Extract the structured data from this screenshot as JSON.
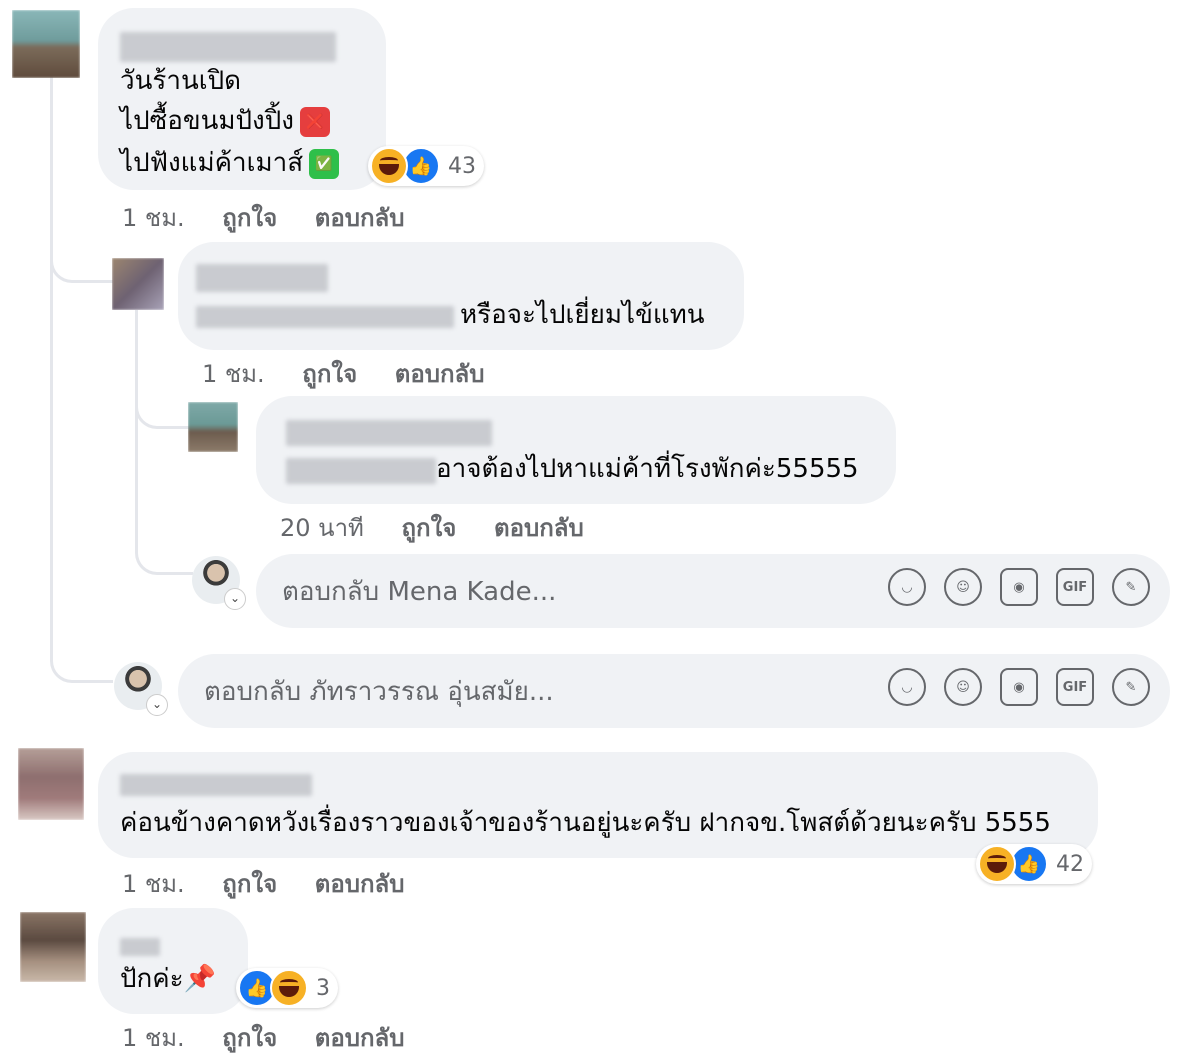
{
  "comments": [
    {
      "lines": [
        "วันร้านเปิด",
        "ไปซื้อขนมปังปิ้ง",
        "ไปฟังแม่ค้าเมาส์"
      ],
      "reaction_count": "43",
      "time": "1 ชม.",
      "like": "ถูกใจ",
      "reply": "ตอบกลับ",
      "emoji_1": "❌",
      "emoji_2": "✅"
    },
    {
      "text": "หรือจะไปเยี่ยมไข้แทน",
      "time": "1 ชม.",
      "like": "ถูกใจ",
      "reply": "ตอบกลับ"
    },
    {
      "text": "อาจต้องไปหาแม่ค้าที่โรงพักค่ะ55555",
      "time": "20 นาที",
      "like": "ถูกใจ",
      "reply": "ตอบกลับ"
    },
    {
      "text": "ค่อนข้างคาดหวังเรื่องราวของเจ้าของร้านอยู่นะครับ ฝากจข.โพสต์ด้วยนะครับ 5555",
      "reaction_count": "42",
      "time": "1 ชม.",
      "like": "ถูกใจ",
      "reply": "ตอบกลับ"
    },
    {
      "text": "ปักค่ะ",
      "emoji": "📌",
      "reaction_count": "3",
      "time": "1 ชม.",
      "like": "ถูกใจ",
      "reply": "ตอบกลับ"
    }
  ],
  "reply_inputs": [
    {
      "placeholder": "ตอบกลับ Mena Kade..."
    },
    {
      "placeholder": "ตอบกลับ ภัทราวรรณ อุ่นสมัย..."
    }
  ],
  "icons": {
    "sticker": "sticker-icon",
    "emoji": "emoji-icon",
    "camera": "camera-icon",
    "gif": "gif-icon",
    "avatar_sticker": "avatar-sticker-icon",
    "gif_label": "GIF"
  },
  "colors": {
    "bubble": "#f0f2f5",
    "meta": "#65676b",
    "like_blue": "#1877f2",
    "haha_yellow": "#f7b125"
  }
}
